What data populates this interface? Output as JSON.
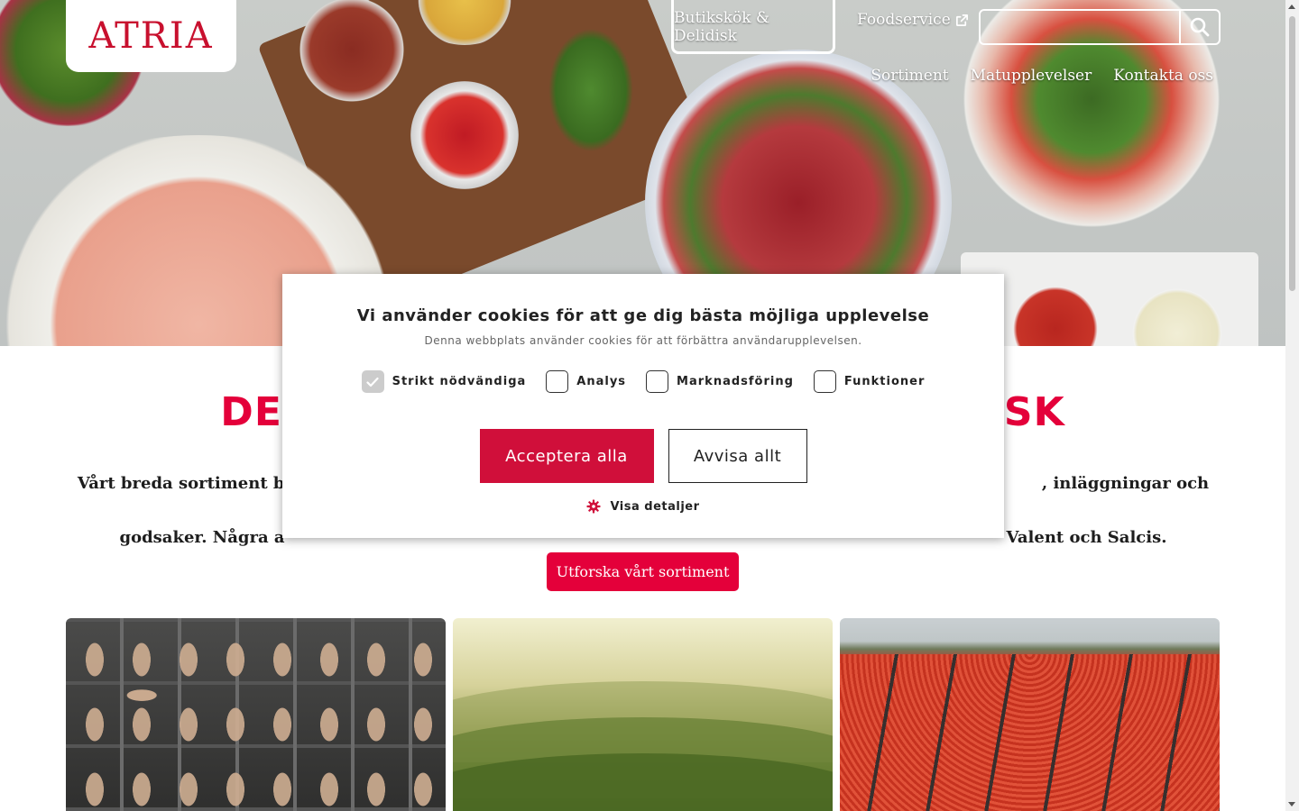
{
  "brand": {
    "logo_text": "ATRIA",
    "accent": "#e4003a"
  },
  "top_nav": {
    "active_tab": "Butikskök & Delidisk",
    "foodservice_link": "Foodservice",
    "search_placeholder": ""
  },
  "main_nav": [
    "Sortiment",
    "Matupplevelser",
    "Kontakta oss"
  ],
  "content": {
    "headline_left": "DE",
    "headline_right": "SK",
    "intro_line1_left": "Vårt breda sortiment består av",
    "intro_line1_right": ", inläggningar och många fler",
    "intro_line2_left": "godsaker. Några a",
    "intro_line2_right": "Valent och Salcis.",
    "cta_label": "Utforska vårt sortiment"
  },
  "cookie": {
    "title": "Vi använder cookies för att ge dig bästa möjliga upplevelse",
    "description": "Denna webbplats använder cookies för att förbättra användarupplevelsen.",
    "options": [
      {
        "label": "Strikt nödvändiga",
        "checked": true
      },
      {
        "label": "Analys",
        "checked": false
      },
      {
        "label": "Marknadsföring",
        "checked": false
      },
      {
        "label": "Funktioner",
        "checked": false
      }
    ],
    "accept_label": "Acceptera alla",
    "reject_label": "Avvisa allt",
    "details_label": "Visa detaljer"
  },
  "icons": {
    "search": "search-icon",
    "external": "external-link-icon",
    "settings": "gear-icon",
    "check": "check-icon"
  }
}
